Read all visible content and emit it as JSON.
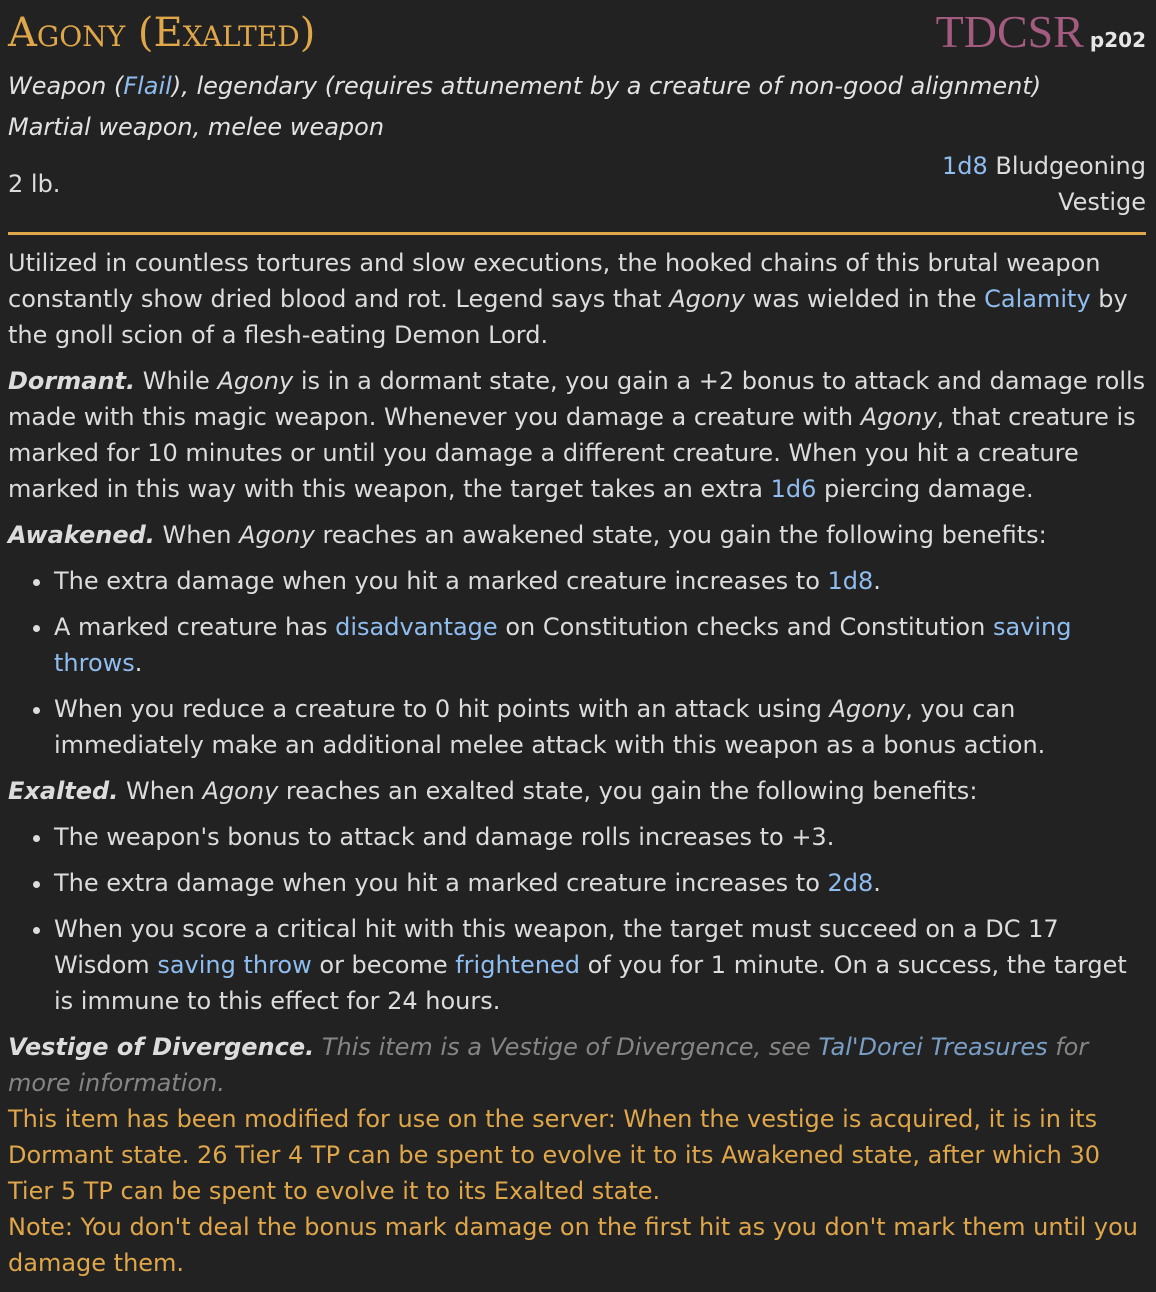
{
  "header": {
    "title": "Agony (Exalted)",
    "source": "TDCSR",
    "page": "p202"
  },
  "subtitle": {
    "line1_pre": "Weapon (",
    "line1_link": "Flail",
    "line1_post": "), legendary (requires attunement by a creature of non-good alignment)",
    "line2": "Martial weapon, melee weapon"
  },
  "stats": {
    "weight": "2 lb.",
    "damage_dice": "1d8",
    "damage_type": "Bludgeoning",
    "property": "Vestige"
  },
  "intro": {
    "t1": "Utilized in countless tortures and slow executions, the hooked chains of this brutal weapon constantly show dried blood and rot. Legend says that ",
    "t2": "Agony",
    "t3": " was wielded in the ",
    "link": "Calamity",
    "t4": " by the gnoll scion of a flesh-eating Demon Lord."
  },
  "dormant": {
    "head": "Dormant.",
    "t1": " While ",
    "t2": "Agony",
    "t3": " is in a dormant state, you gain a +2 bonus to attack and damage rolls made with this magic weapon. Whenever you damage a creature with ",
    "t4": "Agony",
    "t5": ", that creature is marked for 10 minutes or until you damage a different creature. When you hit a creature marked in this way with this weapon, the target takes an extra ",
    "dice": "1d6",
    "t6": " piercing damage."
  },
  "awakened": {
    "head": "Awakened.",
    "t1": " When ",
    "t2": "Agony",
    "t3": " reaches an awakened state, you gain the following benefits:",
    "b1_pre": "The extra damage when you hit a marked creature increases to ",
    "b1_dice": "1d8",
    "b1_post": ".",
    "b2_pre": "A marked creature has ",
    "b2_link1": "disadvantage",
    "b2_mid": " on Constitution checks and Constitution ",
    "b2_link2": "saving throws",
    "b2_post": ".",
    "b3_pre": "When you reduce a creature to 0 hit points with an attack using ",
    "b3_it": "Agony",
    "b3_post": ", you can immediately make an additional melee attack with this weapon as a bonus action."
  },
  "exalted": {
    "head": "Exalted.",
    "t1": " When ",
    "t2": "Agony",
    "t3": " reaches an exalted state, you gain the following benefits:",
    "b1": "The weapon's bonus to attack and damage rolls increases to +3.",
    "b2_pre": "The extra damage when you hit a marked creature increases to ",
    "b2_dice": "2d8",
    "b2_post": ".",
    "b3_pre": "When you score a critical hit with this weapon, the target must succeed on a DC 17 Wisdom ",
    "b3_link1": "saving throw",
    "b3_mid": " or become ",
    "b3_link2": "frightened",
    "b3_post": " of you for 1 minute. On a success, the target is immune to this effect for 24 hours."
  },
  "vestige": {
    "head": "Vestige of Divergence.",
    "t1": " This item is a Vestige of Divergence, see ",
    "link": "Tal'Dorei Treasures",
    "t2": " for more information."
  },
  "notes": {
    "server": "This item has been modified for use on the server: When the vestige is acquired, it is in its Dormant state. 26 Tier 4 TP can be spent to evolve it to its Awakened state, after which 30 Tier 5 TP can be spent to evolve it to its Exalted state.",
    "note": "Note: You don't deal the bonus mark damage on the first hit as you don't mark them until you damage them."
  }
}
